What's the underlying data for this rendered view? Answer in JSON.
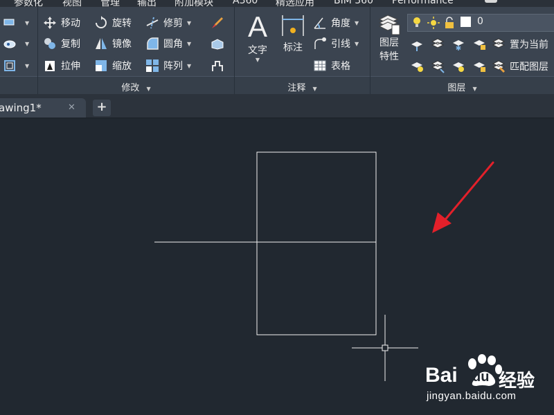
{
  "top_tabs": [
    "参数化",
    "视图",
    "管理",
    "输出",
    "附加模块",
    "A360",
    "精选应用",
    "BIM 360",
    "Performance"
  ],
  "modify": {
    "move": "移动",
    "rotate": "旋转",
    "trim": "修剪",
    "copy": "复制",
    "mirror": "镜像",
    "fillet": "圆角",
    "stretch": "拉伸",
    "scale": "缩放",
    "array": "阵列",
    "footer": "修改"
  },
  "annotation": {
    "text": "文字",
    "dimension": "标注",
    "angle": "角度",
    "leader": "引线",
    "table": "表格",
    "footer": "注释"
  },
  "layers": {
    "properties_line1": "图层",
    "properties_line2": "特性",
    "current_layer": "0",
    "set_current": "置为当前",
    "match_layer": "匹配图层",
    "footer": "图层"
  },
  "document": {
    "tab_title": "awing1*",
    "close_glyph": "✕",
    "new_tab_glyph": "+"
  },
  "watermark": {
    "brand": "Bai",
    "brand2": "du",
    "brand_cn": "经验",
    "url": "jingyan.baidu.com"
  },
  "colors": {
    "canvas_bg": "#212830",
    "ribbon_bg": "#3b4450",
    "arrow": "#e3202a"
  }
}
